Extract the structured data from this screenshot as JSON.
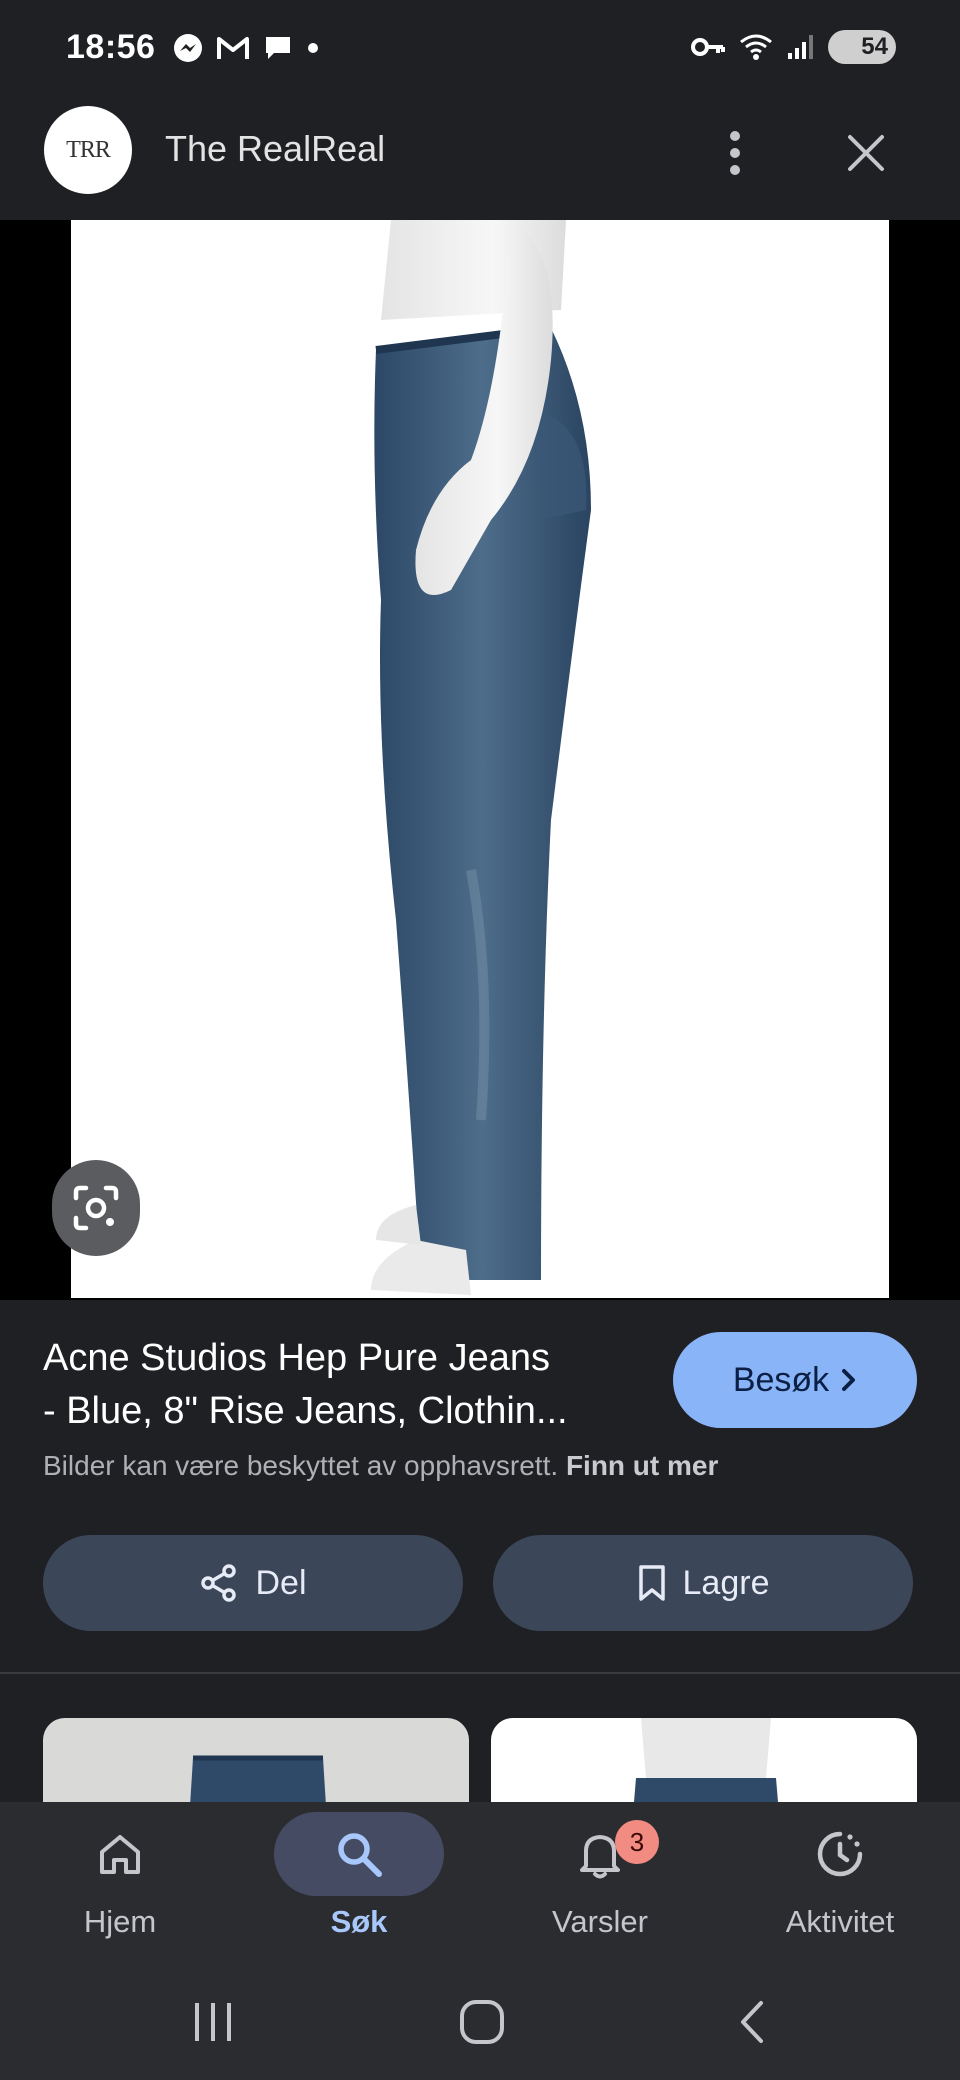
{
  "status_bar": {
    "time": "18:56",
    "battery": "54",
    "icons": [
      "messenger-icon",
      "gmail-icon",
      "chat-icon",
      "dot-icon",
      "vpn-key-icon",
      "wifi-icon",
      "signal-icon",
      "battery-icon"
    ]
  },
  "header": {
    "logo_text": "TRR",
    "site_name": "The RealReal"
  },
  "product": {
    "title_line1": "Acne Studios Hep Pure Jeans",
    "title_line2": "- Blue, 8\" Rise Jeans, Clothin...",
    "visit_label": "Besøk",
    "copyright_text": "Bilder kan være beskyttet av opphavsrett.",
    "learn_more_label": "Finn ut mer",
    "share_label": "Del",
    "save_label": "Lagre"
  },
  "bottom_nav": {
    "items": [
      {
        "label": "Hjem",
        "icon": "home-icon",
        "active": false
      },
      {
        "label": "Søk",
        "icon": "search-icon",
        "active": true
      },
      {
        "label": "Varsler",
        "icon": "bell-icon",
        "active": false,
        "badge": "3"
      },
      {
        "label": "Aktivitet",
        "icon": "activity-icon",
        "active": false
      }
    ]
  },
  "colors": {
    "background": "#1f2024",
    "accent": "#8ab4f8",
    "action_button": "#3c4659",
    "badge": "#f28b82"
  }
}
